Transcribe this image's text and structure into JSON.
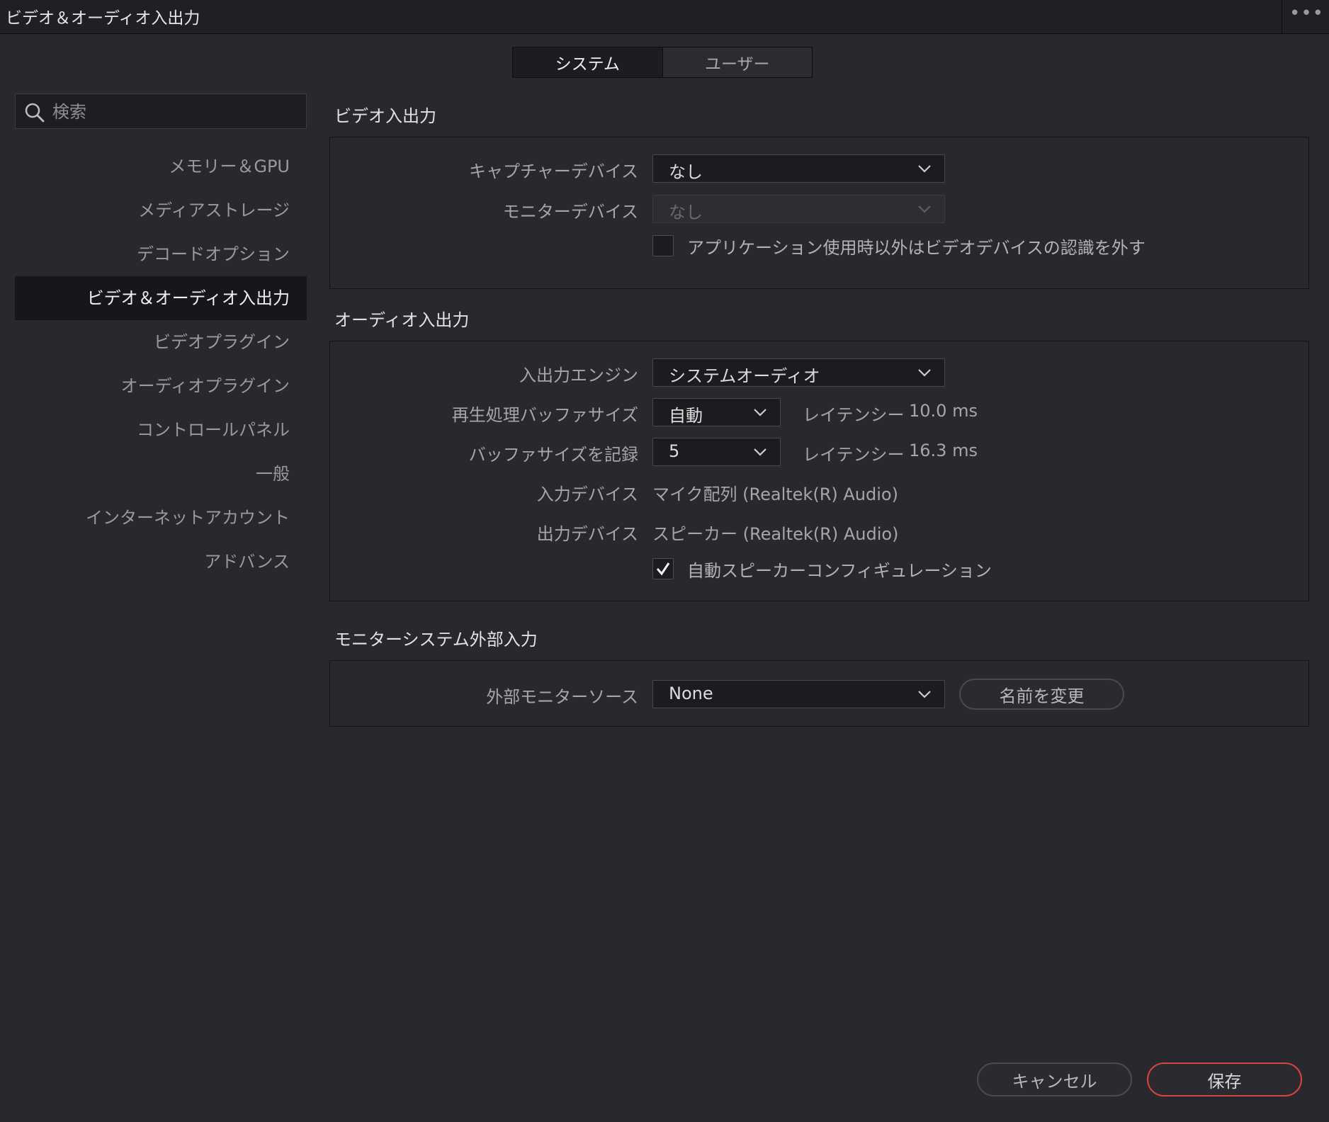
{
  "window": {
    "title": "ビデオ＆オーディオ入出力",
    "more_icon": "•••"
  },
  "tabs": [
    {
      "label": "システム",
      "active": true
    },
    {
      "label": "ユーザー",
      "active": false
    }
  ],
  "search": {
    "placeholder": "検索",
    "value": ""
  },
  "sidebar": {
    "items": [
      {
        "label": "メモリー＆GPU"
      },
      {
        "label": "メディアストレージ"
      },
      {
        "label": "デコードオプション"
      },
      {
        "label": "ビデオ＆オーディオ入出力",
        "active": true
      },
      {
        "label": "ビデオプラグイン"
      },
      {
        "label": "オーディオプラグイン"
      },
      {
        "label": "コントロールパネル"
      },
      {
        "label": "一般"
      },
      {
        "label": "インターネットアカウント"
      },
      {
        "label": "アドバンス"
      }
    ]
  },
  "video_io": {
    "title": "ビデオ入出力",
    "capture_device": {
      "label": "キャプチャーデバイス",
      "value": "なし"
    },
    "monitor_device": {
      "label": "モニターデバイス",
      "value": "なし",
      "disabled": true
    },
    "release_devices": {
      "label": "アプリケーション使用時以外はビデオデバイスの認識を外す",
      "checked": false
    }
  },
  "audio_io": {
    "title": "オーディオ入出力",
    "io_engine": {
      "label": "入出力エンジン",
      "value": "システムオーディオ"
    },
    "playback_buffer": {
      "label": "再生処理バッファサイズ",
      "value": "自動",
      "latency_label": "レイテンシー",
      "latency_value": "10.0 ms"
    },
    "record_buffer": {
      "label": "バッファサイズを記録",
      "value": "5",
      "latency_label": "レイテンシー",
      "latency_value": "16.3 ms"
    },
    "input_device": {
      "label": "入力デバイス",
      "value": "マイク配列 (Realtek(R) Audio)"
    },
    "output_device": {
      "label": "出力デバイス",
      "value": "スピーカー (Realtek(R) Audio)"
    },
    "auto_speaker": {
      "label": "自動スピーカーコンフィギュレーション",
      "checked": true
    }
  },
  "monitor_input": {
    "title": "モニターシステム外部入力",
    "source": {
      "label": "外部モニターソース",
      "value": "None"
    },
    "rename_label": "名前を変更"
  },
  "footer": {
    "cancel_label": "キャンセル",
    "save_label": "保存"
  },
  "colors": {
    "background": "#28282e",
    "accent": "#d6443b"
  }
}
